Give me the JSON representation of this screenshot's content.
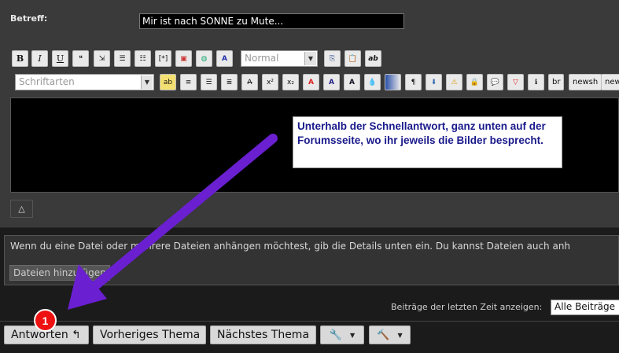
{
  "form": {
    "subject_label": "Betreff:",
    "subject_value": "Mir ist nach SONNE zu Mute..."
  },
  "toolbar1": {
    "bold": "B",
    "italic": "I",
    "underline": "U",
    "format_select": "Normal",
    "italic_ab": "ab"
  },
  "toolbar2": {
    "font_select": "Schriftarten",
    "br": "br",
    "newsh": "newsh",
    "new": "new"
  },
  "editor": {
    "note": "Unterhalb der Schnellantwort, ganz unten auf der Forumsseite, wo ihr jeweils die Bilder besprecht."
  },
  "collapse": "△",
  "attachments": {
    "text": "Wenn du eine Datei oder mehrere Dateien anhängen möchtest, gib die Details unten ein. Du kannst Dateien auch anh",
    "button": "Dateien hinzufügen"
  },
  "recent": {
    "label": "Beiträge der letzten Zeit anzeigen:",
    "value": "Alle Beiträge"
  },
  "actions": {
    "reply": "Antworten ↰",
    "previous": "Vorheriges Thema",
    "next": "Nächstes Thema"
  },
  "annotation": {
    "badge": "1",
    "arrow_color": "#8a2be2"
  }
}
